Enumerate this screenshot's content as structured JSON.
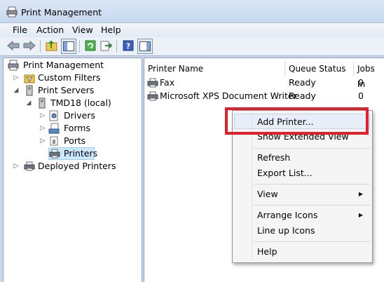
{
  "window": {
    "title": "Print Management"
  },
  "menubar": [
    "File",
    "Action",
    "View",
    "Help"
  ],
  "tree": {
    "root": "Print Management",
    "custom_filters": "Custom Filters",
    "print_servers": "Print Servers",
    "server": "TMD18 (local)",
    "drivers": "Drivers",
    "forms": "Forms",
    "ports": "Ports",
    "printers": "Printers",
    "deployed": "Deployed Printers"
  },
  "columns": {
    "name": "Printer Name",
    "status": "Queue Status",
    "jobs": "Jobs In"
  },
  "rows": [
    {
      "name": "Fax",
      "status": "Ready",
      "jobs": "0"
    },
    {
      "name": "Microsoft XPS Document Writer",
      "status": "Ready",
      "jobs": "0"
    }
  ],
  "context_menu": {
    "add_printer": "Add Printer...",
    "show_extended": "Show Extended View",
    "refresh": "Refresh",
    "export": "Export List...",
    "view": "View",
    "arrange": "Arrange Icons",
    "lineup": "Line up Icons",
    "help": "Help"
  },
  "colors": {
    "highlight": "#e0202a",
    "selection": "#cce8ff"
  }
}
